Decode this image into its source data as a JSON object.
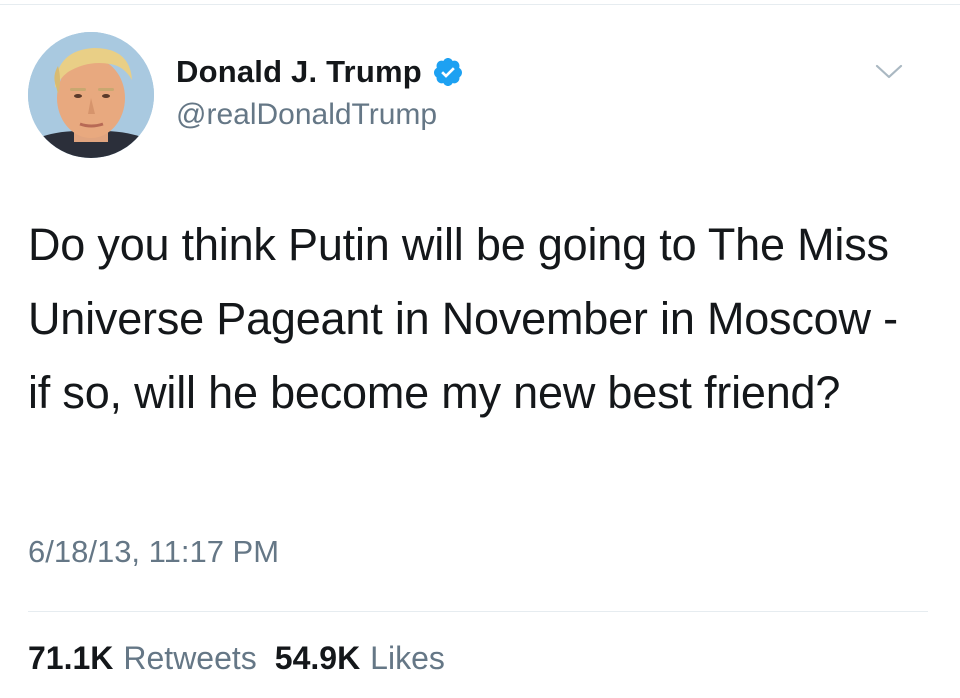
{
  "tweet": {
    "author": {
      "display_name": "Donald J. Trump",
      "handle": "@realDonaldTrump",
      "verified_icon": "verified-badge-icon",
      "verified_color": "#1da1f2"
    },
    "text": "Do you think Putin will be going to The Miss Universe Pageant in November in Moscow - if so, will he become my new best friend?",
    "timestamp": "6/18/13, 11:17 PM",
    "stats": {
      "retweets_count": "71.1K",
      "retweets_label": "Retweets",
      "likes_count": "54.9K",
      "likes_label": "Likes"
    },
    "menu_icon": "chevron-down-icon"
  },
  "colors": {
    "text_primary": "#14171a",
    "text_secondary": "#657786",
    "divider": "#e6ecf0",
    "accent": "#1da1f2"
  }
}
